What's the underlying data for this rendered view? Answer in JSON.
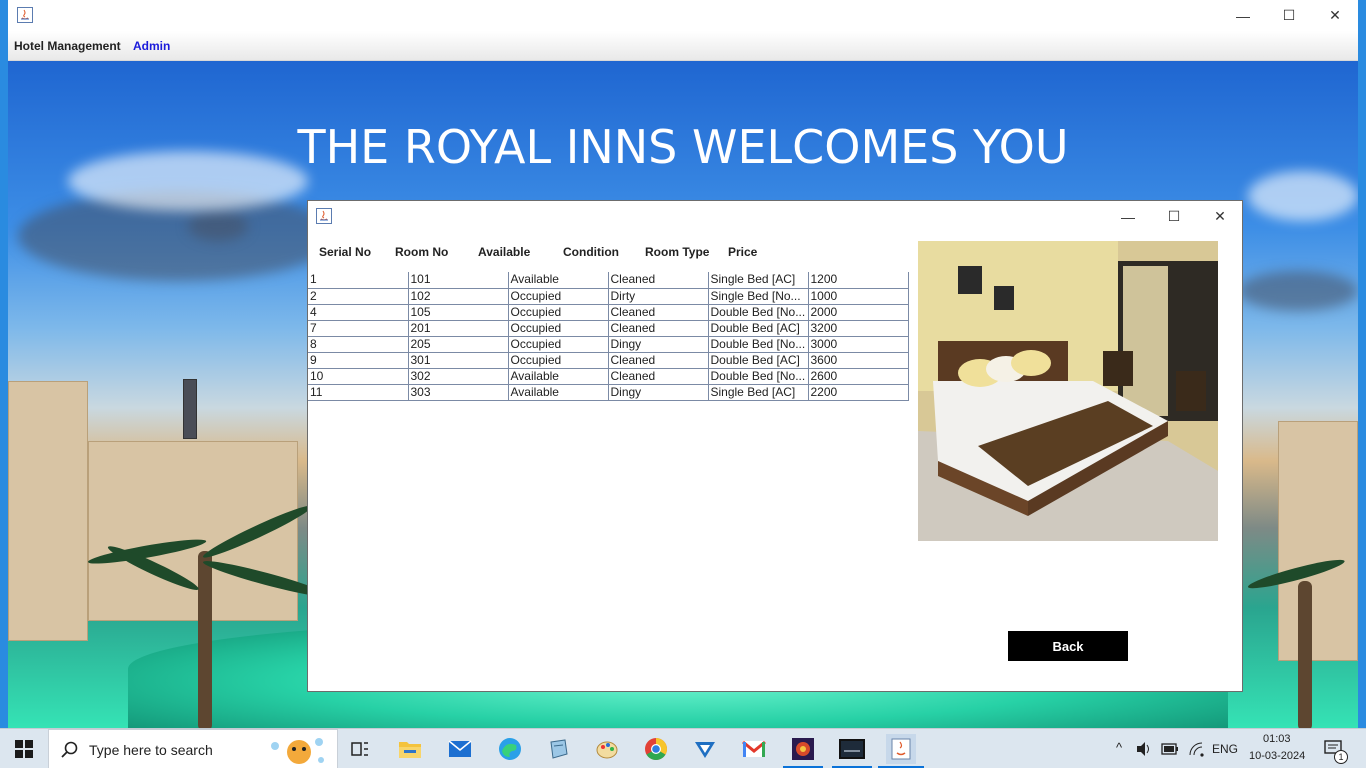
{
  "outer_window": {
    "menu": {
      "app_label": "Hotel Management",
      "user_label": "Admin"
    },
    "controls": {
      "minimize": "—",
      "maximize": "☐",
      "close": "✕"
    }
  },
  "background": {
    "welcome_text": "THE ROYAL INNS WELCOMES YOU"
  },
  "dialog": {
    "controls": {
      "minimize": "—",
      "maximize": "☐",
      "close": "✕"
    },
    "columns": [
      "Serial No",
      "Room No",
      "Available",
      "Condition",
      "Room Type",
      "Price"
    ],
    "rows": [
      [
        "1",
        "101",
        "Available",
        "Cleaned",
        "Single Bed [AC]",
        "1200"
      ],
      [
        "2",
        "102",
        "Occupied",
        "Dirty",
        "Single Bed [No...",
        "1000"
      ],
      [
        "4",
        "105",
        "Occupied",
        "Cleaned",
        "Double Bed [No...",
        "2000"
      ],
      [
        "7",
        "201",
        "Occupied",
        "Cleaned",
        "Double Bed [AC]",
        "3200"
      ],
      [
        "8",
        "205",
        "Occupied",
        "Dingy",
        "Double Bed [No...",
        "3000"
      ],
      [
        "9",
        "301",
        "Occupied",
        "Cleaned",
        "Double Bed [AC]",
        "3600"
      ],
      [
        "10",
        "302",
        "Available",
        "Cleaned",
        "Double Bed [No...",
        "2600"
      ],
      [
        "11",
        "303",
        "Available",
        "Dingy",
        "Single Bed [AC]",
        "2200"
      ]
    ],
    "back_label": "Back"
  },
  "taskbar": {
    "search_placeholder": "Type here to search",
    "tray": {
      "language": "ENG",
      "time": "01:03",
      "date": "10-03-2024",
      "notification_count": "1"
    },
    "apps": [
      "task-view",
      "file-explorer",
      "mail",
      "edge",
      "notepad",
      "paint",
      "chrome",
      "teamviewer",
      "gmail",
      "app-tool",
      "mysql",
      "java"
    ]
  },
  "colors": {
    "accent": "#0a72d8",
    "menu_user": "#1a1adb",
    "button_bg": "#000000"
  }
}
